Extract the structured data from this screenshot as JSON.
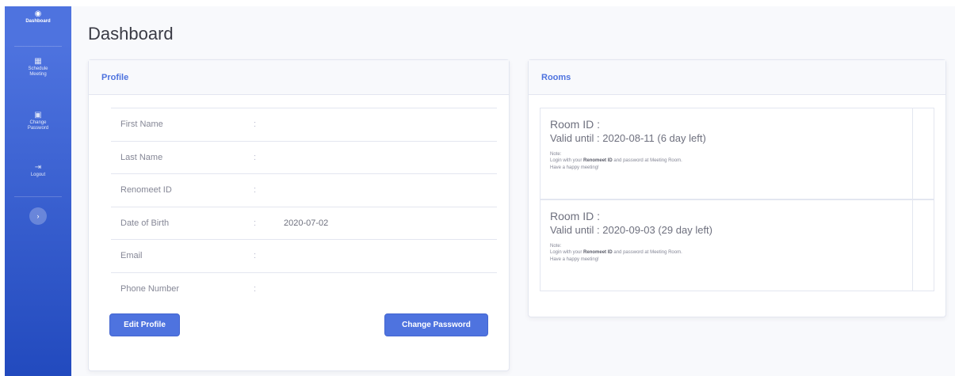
{
  "sidebar": {
    "items": [
      {
        "label": "Dashboard",
        "icon": "tachometer-icon"
      },
      {
        "label": "Schedule Meeting",
        "icon": "calendar-icon"
      },
      {
        "label": "Change Password",
        "icon": "lock-icon"
      },
      {
        "label": "Logout",
        "icon": "logout-icon"
      }
    ],
    "toggle_glyph": "›"
  },
  "page": {
    "title": "Dashboard"
  },
  "profile": {
    "header": "Profile",
    "rows": [
      {
        "label": "First Name",
        "value": ""
      },
      {
        "label": "Last Name",
        "value": ""
      },
      {
        "label": "Renomeet ID",
        "value": ""
      },
      {
        "label": "Date of Birth",
        "value": "2020-07-02"
      },
      {
        "label": "Email",
        "value": ""
      },
      {
        "label": "Phone Number",
        "value": ""
      }
    ],
    "colon": ":",
    "edit_button": "Edit Profile",
    "change_password_button": "Change Password"
  },
  "rooms": {
    "header": "Rooms",
    "items": [
      {
        "room_id_label": "Room ID  :",
        "valid_until": "Valid until : 2020-08-11 (6 day left)",
        "note_label": "Note:",
        "note_prefix": "Login with your ",
        "note_bold": "Renomeet ID",
        "note_suffix": " and password at Meeting Room.",
        "note_line2": "Have a happy meeting!"
      },
      {
        "room_id_label": "Room ID  :",
        "valid_until": "Valid until : 2020-09-03 (29 day left)",
        "note_label": "Note:",
        "note_prefix": "Login with your ",
        "note_bold": "Renomeet ID",
        "note_suffix": " and password at Meeting Room.",
        "note_line2": "Have a happy meeting!"
      }
    ]
  },
  "colors": {
    "accent": "#4e73df",
    "sidebar_end": "#224abe",
    "background": "#f8f9fc"
  }
}
